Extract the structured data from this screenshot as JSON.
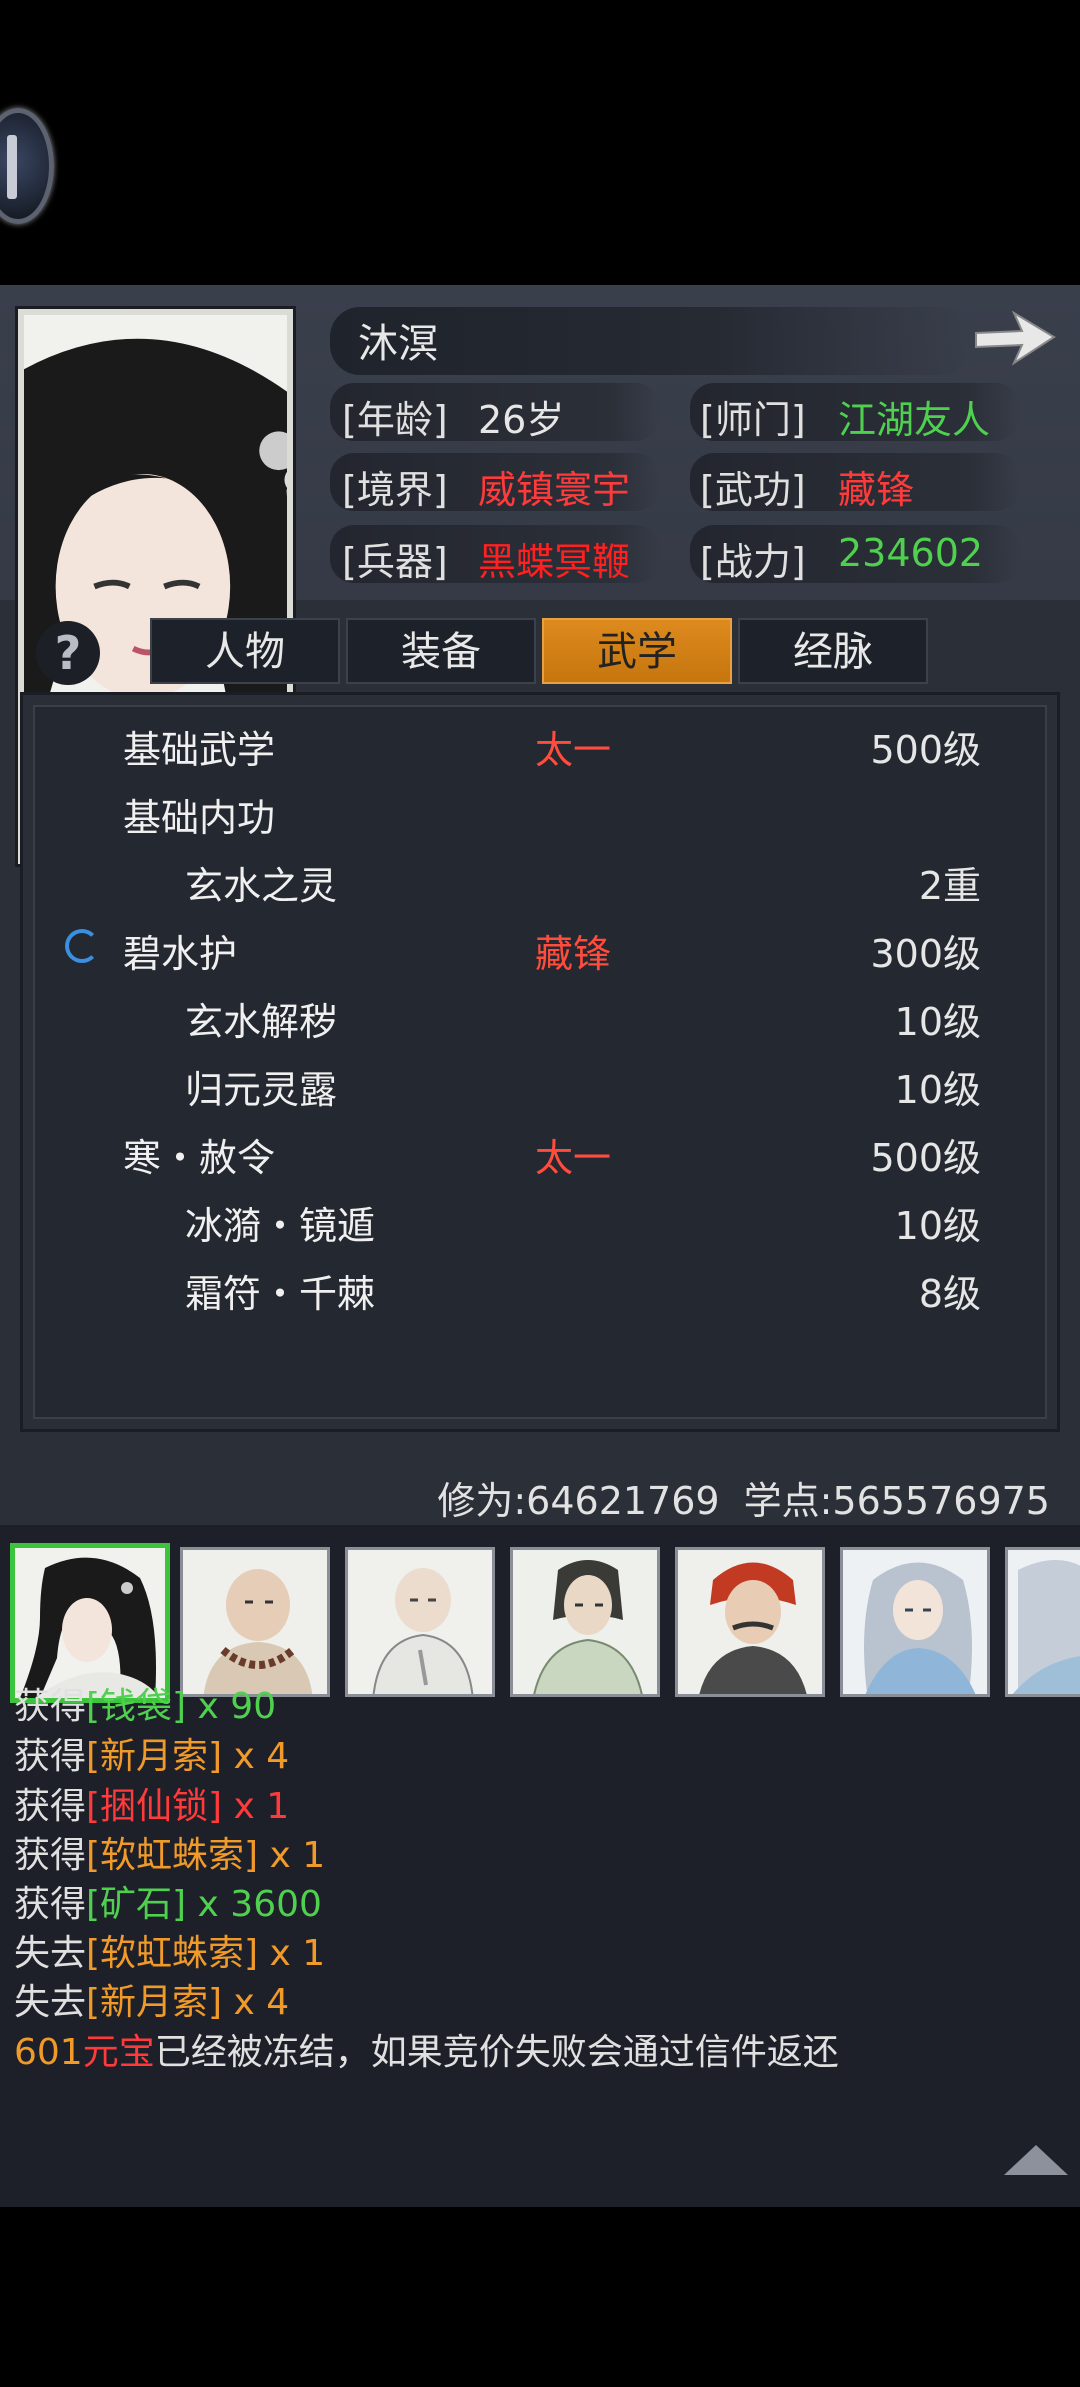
{
  "character": {
    "name": "沐溟",
    "rows": [
      {
        "label": "[年龄]",
        "value": "26岁",
        "label2": "[师门]",
        "value2": "江湖友人"
      },
      {
        "label": "[境界]",
        "value": "威镇寰宇",
        "label2": "[武功]",
        "value2": "藏锋"
      },
      {
        "label": "[兵器]",
        "value": "黑蝶冥鞭",
        "label2": "[战力]",
        "value2": "234602"
      }
    ]
  },
  "tabs": [
    {
      "label": "人物",
      "active": false
    },
    {
      "label": "装备",
      "active": false
    },
    {
      "label": "武学",
      "active": true
    },
    {
      "label": "经脉",
      "active": false
    }
  ],
  "help_label": "?",
  "skills": [
    {
      "name": "基础武学",
      "tag": "太一",
      "level": "500级",
      "indent": false,
      "loading": false
    },
    {
      "name": "基础内功",
      "tag": "",
      "level": "",
      "indent": false,
      "loading": false
    },
    {
      "name": "玄水之灵",
      "tag": "",
      "level": "2重",
      "indent": true,
      "loading": false
    },
    {
      "name": "碧水护",
      "tag": "藏锋",
      "level": "300级",
      "indent": false,
      "loading": true
    },
    {
      "name": "玄水解秽",
      "tag": "",
      "level": "10级",
      "indent": true,
      "loading": false
    },
    {
      "name": "归元灵露",
      "tag": "",
      "level": "10级",
      "indent": true,
      "loading": false
    },
    {
      "name": "寒・赦令",
      "tag": "太一",
      "level": "500级",
      "indent": false,
      "loading": false
    },
    {
      "name": "冰漪・镜遁",
      "tag": "",
      "level": "10级",
      "indent": true,
      "loading": false
    },
    {
      "name": "霜符・千棘",
      "tag": "",
      "level": "8级",
      "indent": true,
      "loading": false
    }
  ],
  "stats": {
    "cultivation": "修为:64621769",
    "points": "学点:565576975"
  },
  "log": [
    {
      "prefix": "获得",
      "item": "[钱袋]",
      "qty": " x 90",
      "color": "g"
    },
    {
      "prefix": "获得",
      "item": "[新月索]",
      "qty": " x 4",
      "color": "o"
    },
    {
      "prefix": "获得",
      "item": "[捆仙锁]",
      "qty": " x 1",
      "color": "r"
    },
    {
      "prefix": "获得",
      "item": "[软虹蛛索]",
      "qty": " x 1",
      "color": "o"
    },
    {
      "prefix": "获得",
      "item": "[矿石]",
      "qty": " x 3600",
      "color": "g"
    },
    {
      "prefix": "失去",
      "item": "[软虹蛛索]",
      "qty": " x 1",
      "color": "o"
    },
    {
      "prefix": "失去",
      "item": "[新月索]",
      "qty": " x 4",
      "color": "o"
    }
  ],
  "notice": {
    "amount": "601",
    "currency": "元宝",
    "text": "已经被冻结，如果竞价失败会通过信件返还"
  },
  "colors": {
    "accent_tab": "#dd8a1e",
    "red": "#ff3a3a",
    "green": "#4fd04f",
    "orange": "#f09a2a"
  }
}
